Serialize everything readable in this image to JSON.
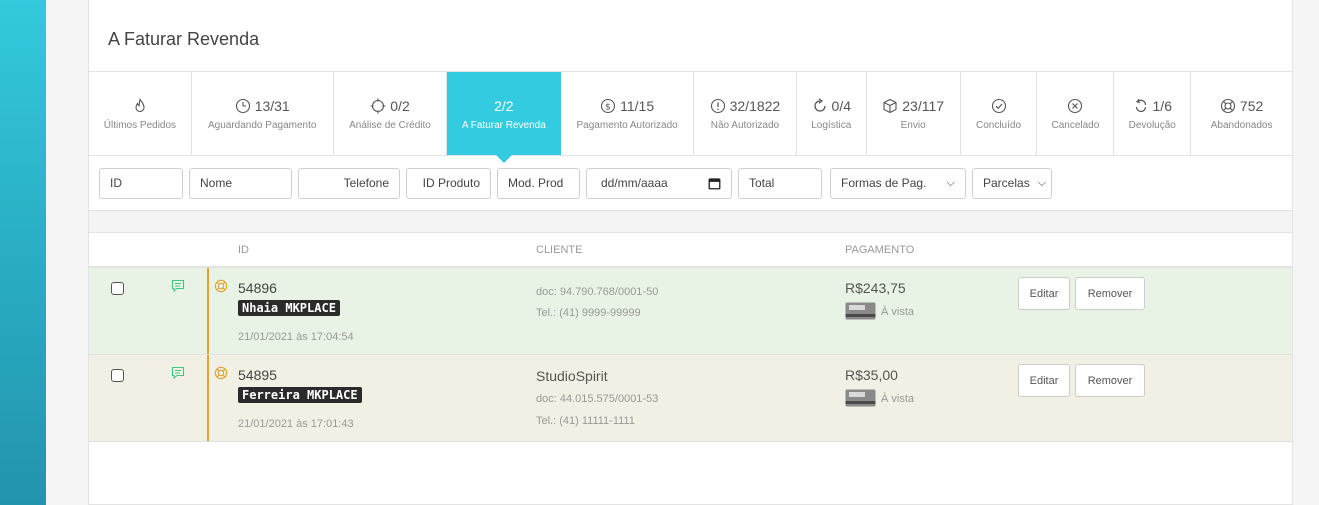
{
  "page": {
    "title": "A Faturar Revenda"
  },
  "tabs": [
    {
      "value": "",
      "label": "Últimos Pedidos",
      "icon": "flame-icon"
    },
    {
      "value": "13/31",
      "label": "Aguardando Pagamento",
      "icon": "clock-icon"
    },
    {
      "value": "0/2",
      "label": "Análise de Crédito",
      "icon": "crosshair-icon"
    },
    {
      "value": "2/2",
      "label": "A Faturar Revenda",
      "icon": "",
      "active": true
    },
    {
      "value": "11/15",
      "label": "Pagamento Autorizado",
      "icon": "dollar-icon"
    },
    {
      "value": "32/1822",
      "label": "Não Autorizado",
      "icon": "alert-icon"
    },
    {
      "value": "0/4",
      "label": "Logística",
      "icon": "refresh-icon"
    },
    {
      "value": "23/117",
      "label": "Envio",
      "icon": "package-icon"
    },
    {
      "value": "",
      "label": "Concluído",
      "icon": "check-circle-icon"
    },
    {
      "value": "",
      "label": "Cancelado",
      "icon": "x-circle-icon"
    },
    {
      "value": "1/6",
      "label": "Devolução",
      "icon": "return-icon"
    },
    {
      "value": "752",
      "label": "Abandonados",
      "icon": "lifebuoy-icon"
    }
  ],
  "filters": {
    "id": "ID",
    "nome": "Nome",
    "telefone": "Telefone",
    "id_produto": "ID Produto",
    "mod_prod": "Mod. Prod",
    "date": "dd/mm/aaaa",
    "total": "Total",
    "formas": "Formas de Pag.",
    "parcelas": "Parcelas"
  },
  "table": {
    "headers": {
      "id": "ID",
      "cliente": "CLIENTE",
      "pagamento": "PAGAMENTO"
    },
    "rows": [
      {
        "id": "54896",
        "tag": "Nhaia MKPLACE",
        "date": "21/01/2021 às 17:04:54",
        "client_name": "",
        "doc": "doc: 94.790.768/0001-50",
        "tel": "Tel.: (41) 9999-99999",
        "price": "R$243,75",
        "payment": "À vista",
        "edit": "Editar",
        "remove": "Remover"
      },
      {
        "id": "54895",
        "tag": "Ferreira MKPLACE",
        "date": "21/01/2021 às 17:01:43",
        "client_name": "StudioSpirit",
        "doc": "doc: 44.015.575/0001-53",
        "tel": "Tel.: (41) 11111-1111",
        "price": "R$35,00",
        "payment": "À vista",
        "edit": "Editar",
        "remove": "Remover"
      }
    ]
  },
  "colors": {
    "sidebar": "#2bb5cb",
    "active_tab": "#33cbe0",
    "row_green": "#e8f3e5",
    "row_beige": "#f2efe4",
    "accent_line": "#e3a32e",
    "comment_icon": "#3cc97f"
  }
}
